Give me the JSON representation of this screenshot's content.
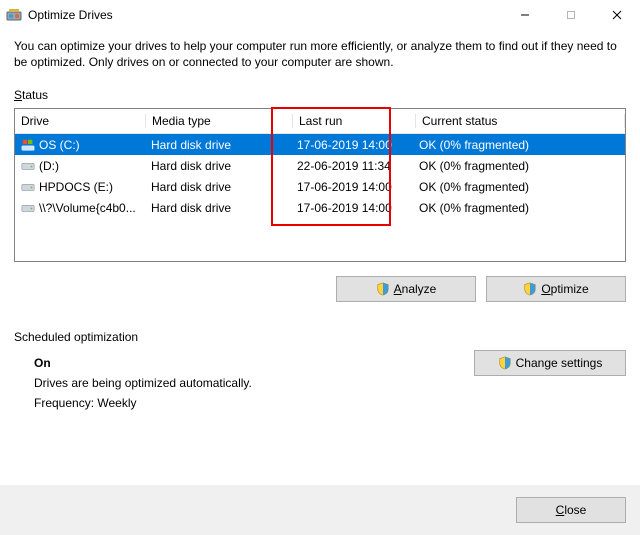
{
  "window": {
    "title": "Optimize Drives"
  },
  "intro": "You can optimize your drives to help your computer run more efficiently, or analyze them to find out if they need to be optimized. Only drives on or connected to your computer are shown.",
  "statusLabel": "Status",
  "columns": {
    "drive": "Drive",
    "mediaType": "Media type",
    "lastRun": "Last run",
    "currentStatus": "Current status"
  },
  "drives": [
    {
      "icon": "os",
      "name": "OS (C:)",
      "media": "Hard disk drive",
      "lastRun": "17-06-2019 14:00",
      "status": "OK (0% fragmented)",
      "selected": true
    },
    {
      "icon": "hdd",
      "name": "(D:)",
      "media": "Hard disk drive",
      "lastRun": "22-06-2019 11:34",
      "status": "OK (0% fragmented)",
      "selected": false
    },
    {
      "icon": "hdd",
      "name": "HPDOCS (E:)",
      "media": "Hard disk drive",
      "lastRun": "17-06-2019 14:00",
      "status": "OK (0% fragmented)",
      "selected": false
    },
    {
      "icon": "hdd",
      "name": "\\\\?\\Volume{c4b0...",
      "media": "Hard disk drive",
      "lastRun": "17-06-2019 14:00",
      "status": "OK (0% fragmented)",
      "selected": false
    }
  ],
  "buttons": {
    "analyze": "Analyze",
    "optimize": "Optimize",
    "changeSettings": "Change settings",
    "close": "Close"
  },
  "scheduled": {
    "heading": "Scheduled optimization",
    "state": "On",
    "desc": "Drives are being optimized automatically.",
    "frequency": "Frequency: Weekly"
  }
}
